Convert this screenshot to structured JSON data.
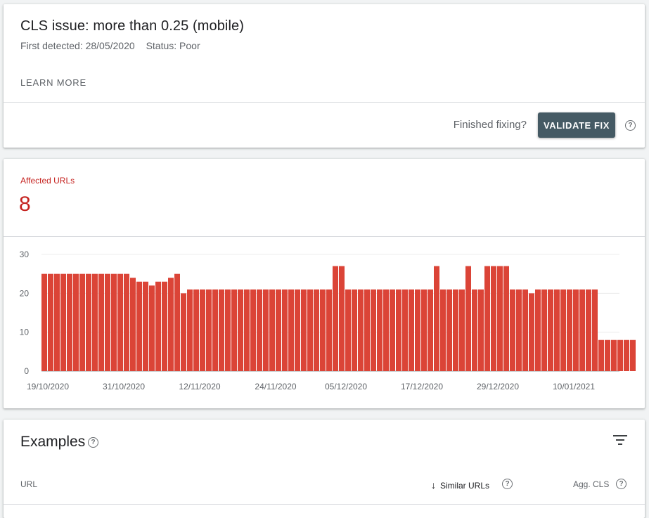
{
  "issue": {
    "title": "CLS issue: more than 0.25 (mobile)",
    "first_detected": "First detected: 28/05/2020",
    "status": "Status: Poor",
    "learn_more": "LEARN MORE",
    "finished_fixing": "Finished fixing?",
    "validate_fix": "VALIDATE FIX"
  },
  "summary": {
    "label": "Affected URLs",
    "count": "8"
  },
  "chart_data": {
    "type": "bar",
    "color": "#db4437",
    "ylim": [
      0,
      30
    ],
    "yticks": [
      "0",
      "10",
      "20",
      "30"
    ],
    "xtick_labels": [
      "19/10/2020",
      "31/10/2020",
      "12/11/2020",
      "24/11/2020",
      "05/12/2020",
      "17/12/2020",
      "29/12/2020",
      "10/01/2021"
    ],
    "values": [
      25,
      25,
      25,
      25,
      25,
      25,
      25,
      25,
      25,
      25,
      25,
      25,
      25,
      25,
      24,
      23,
      23,
      22,
      23,
      23,
      24,
      25,
      20,
      21,
      21,
      21,
      21,
      21,
      21,
      21,
      21,
      21,
      21,
      21,
      21,
      21,
      21,
      21,
      21,
      21,
      21,
      21,
      21,
      21,
      21,
      21,
      27,
      27,
      21,
      21,
      21,
      21,
      21,
      21,
      21,
      21,
      21,
      21,
      21,
      21,
      21,
      21,
      27,
      21,
      21,
      21,
      21,
      27,
      21,
      21,
      27,
      27,
      27,
      27,
      21,
      21,
      21,
      20,
      21,
      21,
      21,
      21,
      21,
      21,
      21,
      21,
      21,
      21,
      8,
      8,
      8,
      8,
      8,
      8
    ]
  },
  "examples": {
    "title": "Examples",
    "columns": {
      "url": "URL",
      "similar": "Similar URLs",
      "cls": "Agg. CLS"
    }
  },
  "icons": {
    "help": "?",
    "sort": "↓"
  }
}
